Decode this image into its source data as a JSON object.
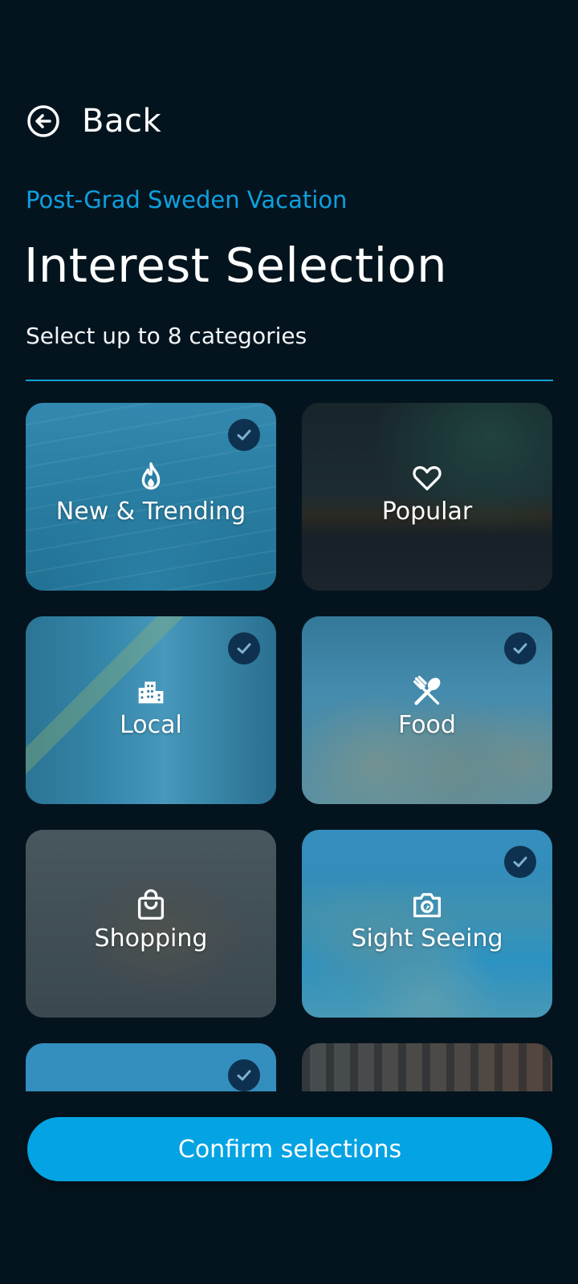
{
  "header": {
    "back_label": "Back",
    "trip_name": "Post-Grad Sweden Vacation",
    "title": "Interest Selection",
    "subtitle": "Select up to 8 categories"
  },
  "categories": [
    {
      "label": "New & Trending",
      "icon": "flame-icon",
      "selected": true
    },
    {
      "label": "Popular",
      "icon": "heart-icon",
      "selected": false
    },
    {
      "label": "Local",
      "icon": "city-icon",
      "selected": true
    },
    {
      "label": "Food",
      "icon": "restaurant-icon",
      "selected": true
    },
    {
      "label": "Shopping",
      "icon": "shopping-bag-icon",
      "selected": false
    },
    {
      "label": "Sight Seeing",
      "icon": "camera-icon",
      "selected": true
    },
    {
      "label": "",
      "icon": "",
      "selected": true
    },
    {
      "label": "",
      "icon": "",
      "selected": false
    }
  ],
  "confirm_label": "Confirm selections",
  "colors": {
    "background": "#04141e",
    "accent": "#04a3e3",
    "trip_name": "#0ea0e0",
    "check_badge": "#0f3150"
  }
}
